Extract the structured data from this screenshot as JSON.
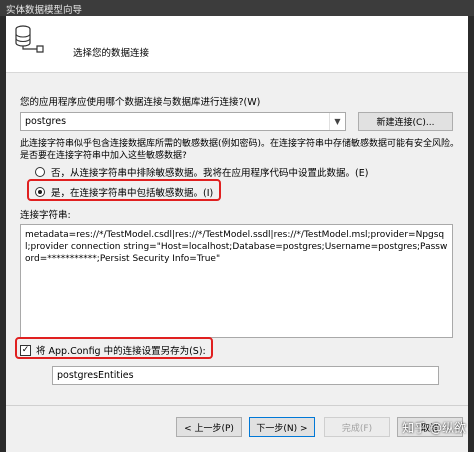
{
  "window": {
    "title": "实体数据模型向导"
  },
  "header": {
    "title": "选择您的数据连接"
  },
  "connection": {
    "question": "您的应用程序应使用哪个数据连接与数据库进行连接?(W)",
    "selected": "postgres",
    "new_button": "新建连接(C)..."
  },
  "sensitive": {
    "desc_line1": "此连接字符串似乎包含连接数据库所需的敏感数据(例如密码)。在连接字符串中存储敏感数据可能有安全风险。",
    "desc_line2": "是否要在连接字符串中加入这些敏感数据?",
    "option_no": "否，从连接字符串中排除敏感数据。我将在应用程序代码中设置此数据。(E)",
    "option_yes": "是，在连接字符串中包括敏感数据。(I)"
  },
  "connection_string": {
    "label": "连接字符串:",
    "value": "metadata=res://*/TestModel.csdl|res://*/TestModel.ssdl|res://*/TestModel.msl;provider=Npgsql;provider connection string=\"Host=localhost;Database=postgres;Username=postgres;Password=***********;Persist Security Info=True\""
  },
  "save": {
    "label": "将 App.Config 中的连接设置另存为(S):",
    "checked_mark": "✓",
    "value": "postgresEntities"
  },
  "footer": {
    "prev": "< 上一步(P)",
    "next": "下一步(N) >",
    "finish": "完成(F)",
    "cancel": "取消"
  },
  "watermark": "知乎 @纵欲"
}
